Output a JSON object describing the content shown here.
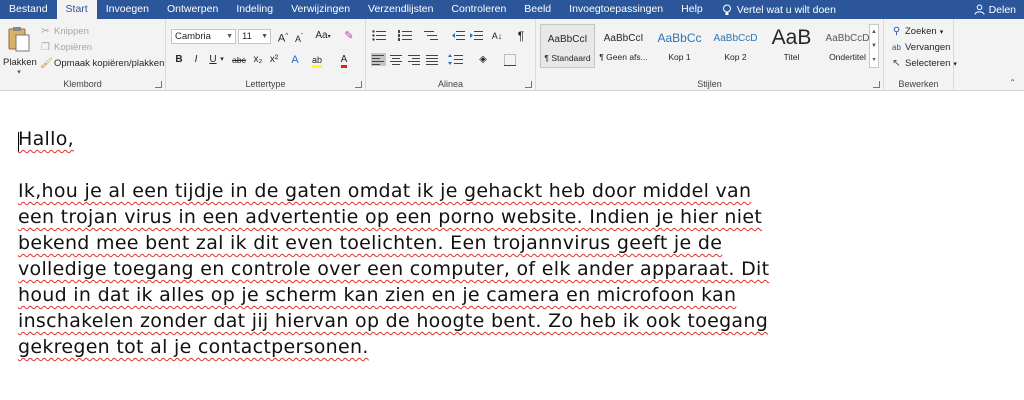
{
  "tabs": [
    "Bestand",
    "Start",
    "Invoegen",
    "Ontwerpen",
    "Indeling",
    "Verwijzingen",
    "Verzendlijsten",
    "Controleren",
    "Beeld",
    "Invoegtoepassingen",
    "Help"
  ],
  "active_tab": "Start",
  "tell_me": "Vertel wat u wilt doen",
  "share": "Delen",
  "clipboard": {
    "paste": "Plakken",
    "cut": "Knippen",
    "copy": "Kopiëren",
    "format_painter": "Opmaak kopiëren/plakken",
    "label": "Klembord"
  },
  "font": {
    "name": "Cambria",
    "size": "11",
    "label": "Lettertype",
    "grow": "A",
    "shrink": "A",
    "case": "Aa",
    "bold": "B",
    "italic": "I",
    "underline": "U",
    "strike": "abc",
    "subscript": "x₂",
    "superscript": "x²",
    "effects": "A",
    "font_color": "A"
  },
  "paragraph": {
    "label": "Alinea"
  },
  "styles": {
    "label": "Stijlen",
    "items": [
      {
        "sample": "AaBbCcI",
        "name": "¶ Standaard"
      },
      {
        "sample": "AaBbCcI",
        "name": "¶ Geen afs..."
      },
      {
        "sample": "AaBbCc",
        "name": "Kop 1"
      },
      {
        "sample": "AaBbCcD",
        "name": "Kop 2"
      },
      {
        "sample": "AaB",
        "name": "Titel"
      },
      {
        "sample": "AaBbCcD",
        "name": "Ondertitel"
      }
    ]
  },
  "editing": {
    "label": "Bewerken",
    "find": "Zoeken",
    "replace": "Vervangen",
    "select": "Selecteren"
  },
  "document": {
    "lines": [
      "Hallo,",
      "",
      "Ik,hou je al een tijdje in de gaten omdat ik je gehackt heb door middel van",
      "een trojan virus in een advertentie op een porno website. Indien je hier niet",
      "bekend mee bent zal ik dit even toelichten. Een trojannvirus geeft je de",
      "volledige toegang en controle over een computer, of elk ander apparaat. Dit",
      "houd  in dat ik alles op je scherm kan zien en je camera en microfoon kan",
      "inschakelen  zonder dat jij hiervan op de hoogte bent. Zo heb ik ook toegang",
      "gekregen tot al  je contactpersonen."
    ]
  },
  "colors": {
    "ribbon_blue": "#2b579a",
    "ribbon_bg": "#f3f3f3",
    "spell_underline": "#e0322d"
  }
}
